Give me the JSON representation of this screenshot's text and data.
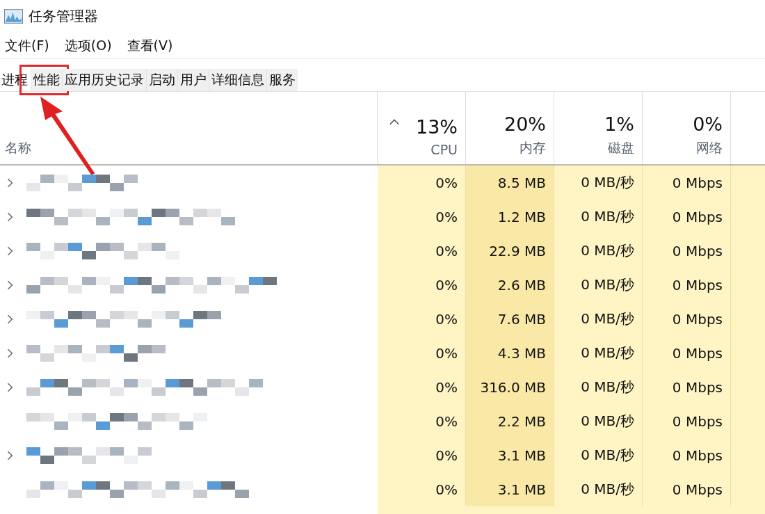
{
  "window": {
    "title": "任务管理器"
  },
  "menu": [
    "文件(F)",
    "选项(O)",
    "查看(V)"
  ],
  "tabs": [
    {
      "label": "进程",
      "selected": true,
      "highlighted": false
    },
    {
      "label": "性能",
      "selected": false,
      "highlighted": true
    },
    {
      "label": "应用历史记录",
      "selected": false,
      "highlighted": false
    },
    {
      "label": "启动",
      "selected": false,
      "highlighted": false
    },
    {
      "label": "用户",
      "selected": false,
      "highlighted": false
    },
    {
      "label": "详细信息",
      "selected": false,
      "highlighted": false
    },
    {
      "label": "服务",
      "selected": false,
      "highlighted": false
    }
  ],
  "table": {
    "name_header": "名称",
    "columns": [
      {
        "usage": "13%",
        "label": "CPU",
        "sorted": true
      },
      {
        "usage": "20%",
        "label": "内存",
        "sorted": false
      },
      {
        "usage": "1%",
        "label": "磁盘",
        "sorted": false
      },
      {
        "usage": "0%",
        "label": "网络",
        "sorted": false
      }
    ],
    "rows": [
      {
        "expandable": true,
        "cells": [
          "0%",
          "8.5 MB",
          "0 MB/秒",
          "0 Mbps"
        ]
      },
      {
        "expandable": true,
        "cells": [
          "0%",
          "1.2 MB",
          "0 MB/秒",
          "0 Mbps"
        ]
      },
      {
        "expandable": true,
        "cells": [
          "0%",
          "22.9 MB",
          "0 MB/秒",
          "0 Mbps"
        ]
      },
      {
        "expandable": true,
        "cells": [
          "0%",
          "2.6 MB",
          "0 MB/秒",
          "0 Mbps"
        ]
      },
      {
        "expandable": true,
        "cells": [
          "0%",
          "7.6 MB",
          "0 MB/秒",
          "0 Mbps"
        ]
      },
      {
        "expandable": true,
        "cells": [
          "0%",
          "4.3 MB",
          "0 MB/秒",
          "0 Mbps"
        ]
      },
      {
        "expandable": true,
        "cells": [
          "0%",
          "316.0 MB",
          "0 MB/秒",
          "0 Mbps"
        ]
      },
      {
        "expandable": false,
        "cells": [
          "0%",
          "2.2 MB",
          "0 MB/秒",
          "0 Mbps"
        ]
      },
      {
        "expandable": true,
        "cells": [
          "0%",
          "3.1 MB",
          "0 MB/秒",
          "0 Mbps"
        ]
      },
      {
        "expandable": false,
        "cells": [
          "0%",
          "3.1 MB",
          "0 MB/秒",
          "0 Mbps"
        ]
      }
    ]
  }
}
